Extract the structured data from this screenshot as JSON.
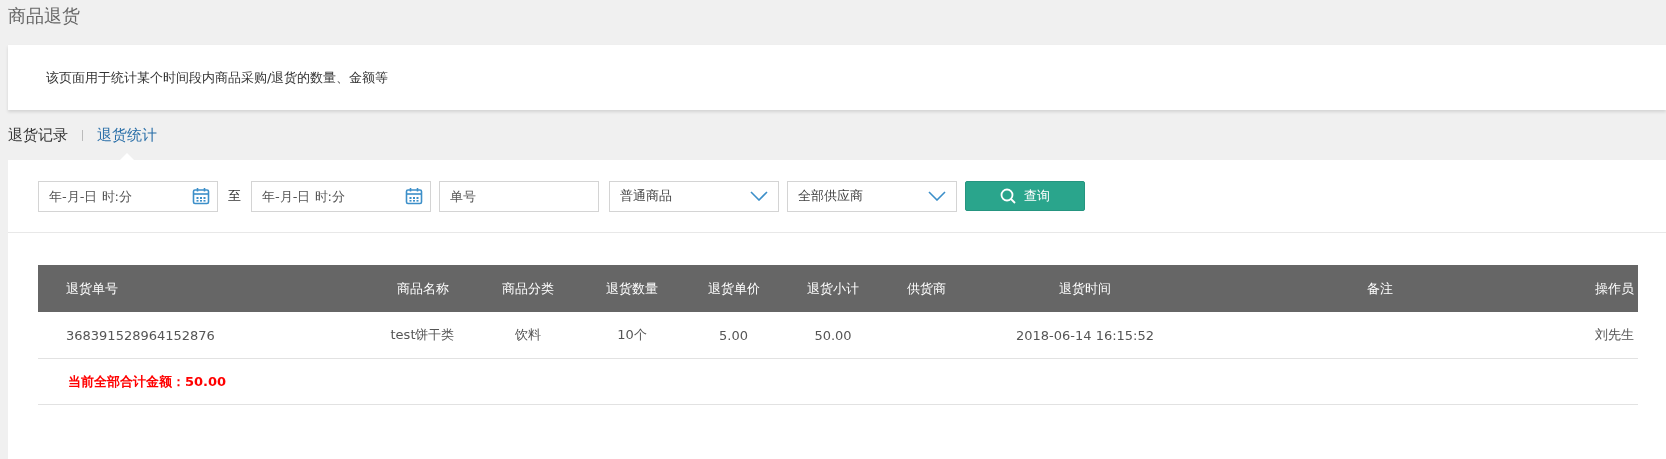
{
  "page_title": "商品退货",
  "notice": "该页面用于统计某个时间段内商品采购/退货的数量、金额等",
  "tabs": [
    {
      "label": "退货记录",
      "selected": false
    },
    {
      "label": "退货统计",
      "selected": true
    }
  ],
  "filters": {
    "start_date": {
      "placeholder": "年-月-日 时:分"
    },
    "range_separator": "至",
    "end_date": {
      "placeholder": "年-月-日 时:分"
    },
    "order_number": {
      "placeholder": "单号"
    },
    "product_type": {
      "value": "普通商品"
    },
    "supplier": {
      "value": "全部供应商"
    },
    "search_button": "查询"
  },
  "table": {
    "columns": [
      "退货单号",
      "商品名称",
      "商品分类",
      "退货数量",
      "退货单价",
      "退货小计",
      "供货商",
      "退货时间",
      "备注",
      "操作员"
    ],
    "rows": [
      {
        "cells": [
          "368391528964152876",
          "test饼干类",
          "饮料",
          "10个",
          "5.00",
          "50.00",
          null,
          "2018-06-14 16:15:52",
          null,
          "刘先生"
        ]
      }
    ],
    "total": "当前全部合计金额：50.00"
  }
}
